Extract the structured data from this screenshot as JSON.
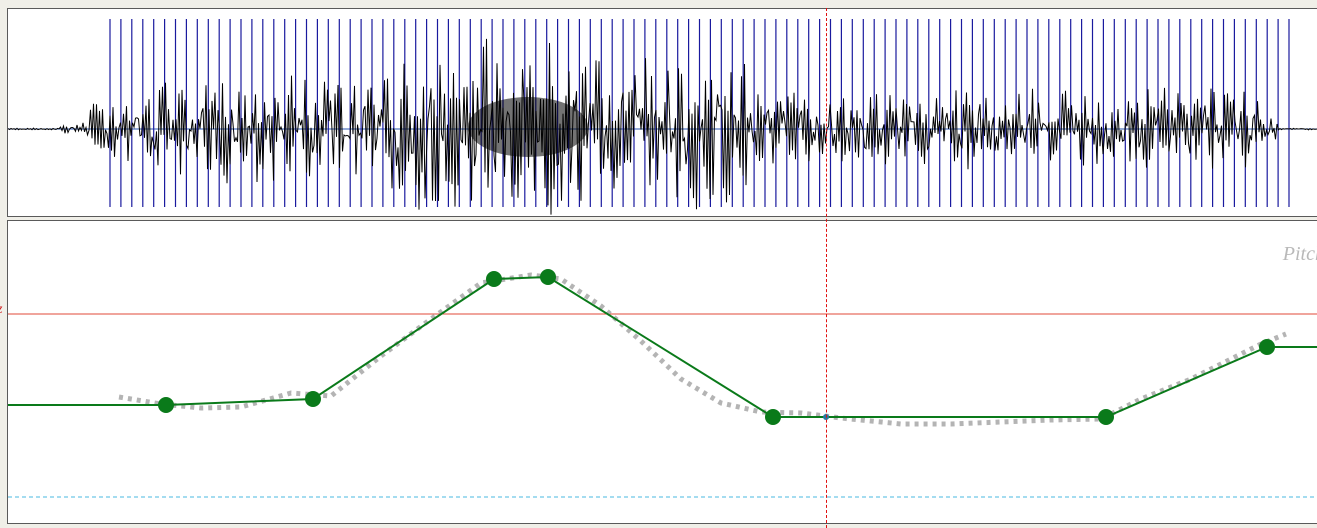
{
  "pitch_panel": {
    "label": "Pitch",
    "ref_marker": "z"
  },
  "waveform": {
    "pulse_count": 109,
    "colors": {
      "wave": "#000000",
      "pulse": "#1a1a9e",
      "baseline": "#2a55b0"
    }
  },
  "pitch": {
    "colors": {
      "stylized": "#0a7a1a",
      "raw": "#b4b4b4",
      "reference": "#e04a3a",
      "floor": "#4ab8e0",
      "cursor": "#e01010"
    },
    "raw_dashed": true
  },
  "cursor": {
    "style": "dashed"
  }
}
